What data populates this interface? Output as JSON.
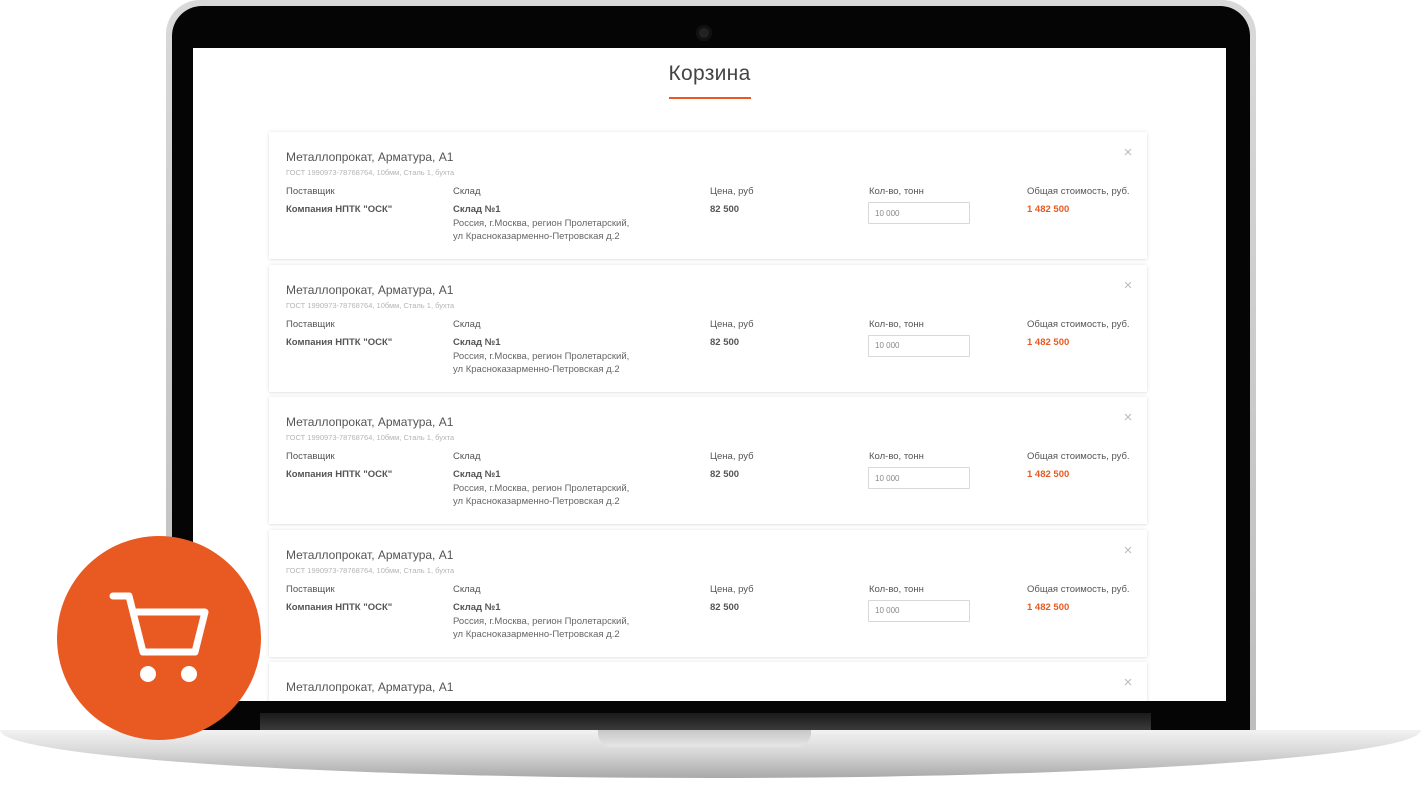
{
  "page": {
    "title": "Корзина",
    "accent_color": "#e85a22"
  },
  "cart": {
    "items": [
      {
        "title": "Металлопрокат, Арматура, А1",
        "gost": "ГОСТ 1990973-78768764, 10бмм, Сталь 1, бухта",
        "supplier_label": "Поставщик",
        "supplier": "Компания НПТК \"ОСК\"",
        "warehouse_label": "Склад",
        "warehouse": "Склад №1",
        "address_line1": "Россия, г.Москва, регион Пролетарский,",
        "address_line2": "ул Красноказарменно-Петровская д.2",
        "price_label": "Цена, руб",
        "price": "82 500",
        "qty_label": "Кол-во, тонн",
        "qty": "10 000",
        "total_label": "Общая стоимость, руб.",
        "total": "1 482 500",
        "close_icon": "×"
      },
      {
        "title": "Металлопрокат, Арматура, А1",
        "gost": "ГОСТ 1990973-78768764, 10бмм, Сталь 1, бухта",
        "supplier_label": "Поставщик",
        "supplier": "Компания НПТК \"ОСК\"",
        "warehouse_label": "Склад",
        "warehouse": "Склад №1",
        "address_line1": "Россия, г.Москва, регион Пролетарский,",
        "address_line2": "ул Красноказарменно-Петровская д.2",
        "price_label": "Цена, руб",
        "price": "82 500",
        "qty_label": "Кол-во, тонн",
        "qty": "10 000",
        "total_label": "Общая стоимость, руб.",
        "total": "1 482 500",
        "close_icon": "×"
      },
      {
        "title": "Металлопрокат, Арматура, А1",
        "gost": "ГОСТ 1990973-78768764, 10бмм, Сталь 1, бухта",
        "supplier_label": "Поставщик",
        "supplier": "Компания НПТК \"ОСК\"",
        "warehouse_label": "Склад",
        "warehouse": "Склад №1",
        "address_line1": "Россия, г.Москва, регион Пролетарский,",
        "address_line2": "ул Красноказарменно-Петровская д.2",
        "price_label": "Цена, руб",
        "price": "82 500",
        "qty_label": "Кол-во, тонн",
        "qty": "10 000",
        "total_label": "Общая стоимость, руб.",
        "total": "1 482 500",
        "close_icon": "×"
      },
      {
        "title": "Металлопрокат, Арматура, А1",
        "gost": "ГОСТ 1990973-78768764, 10бмм, Сталь 1, бухта",
        "supplier_label": "Поставщик",
        "supplier": "Компания НПТК \"ОСК\"",
        "warehouse_label": "Склад",
        "warehouse": "Склад №1",
        "address_line1": "Россия, г.Москва, регион Пролетарский,",
        "address_line2": "ул Красноказарменно-Петровская д.2",
        "price_label": "Цена, руб",
        "price": "82 500",
        "qty_label": "Кол-во, тонн",
        "qty": "10 000",
        "total_label": "Общая стоимость, руб.",
        "total": "1 482 500",
        "close_icon": "×"
      },
      {
        "title": "Металлопрокат, Арматура, А1",
        "close_icon": "×"
      }
    ]
  },
  "badge": {
    "icon": "shopping-cart-icon"
  }
}
